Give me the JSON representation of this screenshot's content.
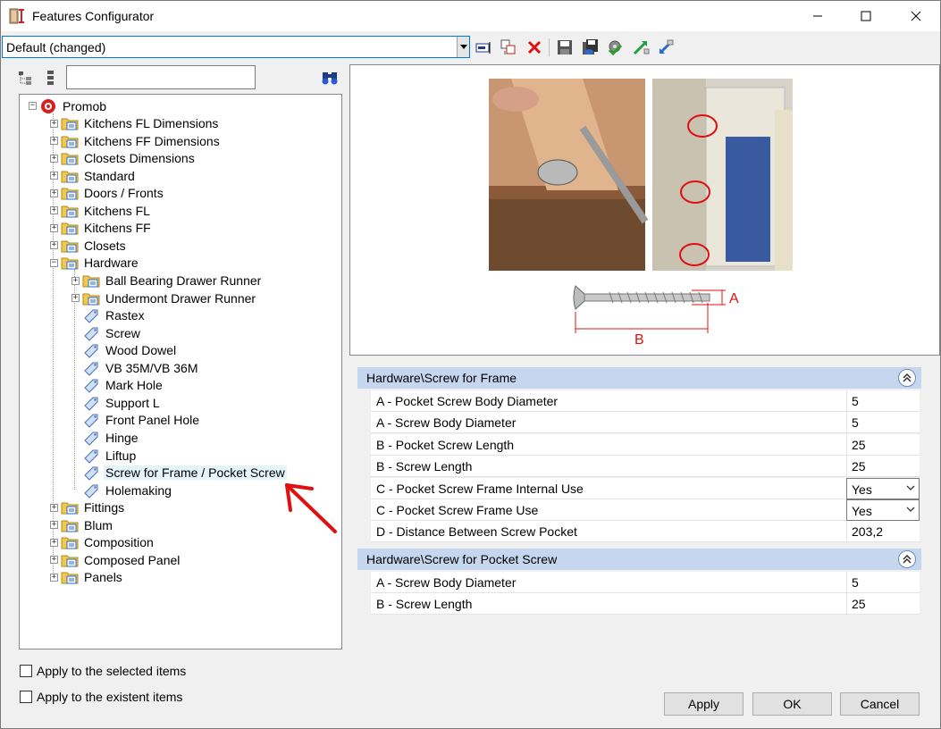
{
  "window": {
    "title": "Features Configurator"
  },
  "toolbar": {
    "profile": "Default (changed)",
    "icons": [
      "rename-icon",
      "copy-icon",
      "delete-icon",
      "save-icon",
      "save-as-icon",
      "settings-check-icon",
      "import-icon",
      "export-icon"
    ]
  },
  "tree": {
    "search_value": "",
    "root": "Promob",
    "items": [
      "Kitchens FL Dimensions",
      "Kitchens FF Dimensions",
      "Closets Dimensions",
      "Standard",
      "Doors / Fronts",
      "Kitchens FL",
      "Kitchens FF",
      "Closets",
      "Hardware"
    ],
    "hardware_children": [
      "Ball Bearing Drawer Runner",
      "Undermont Drawer Runner",
      "Rastex",
      "Screw",
      "Wood Dowel",
      "VB 35M/VB 36M",
      "Mark Hole",
      "Support L",
      "Front Panel Hole",
      "Hinge",
      "Liftup",
      "Screw for Frame / Pocket Screw",
      "Holemaking"
    ],
    "items_after": [
      "Fittings",
      "Blum",
      "Composition",
      "Composed Panel",
      "Panels"
    ],
    "selected": "Screw for Frame / Pocket Screw"
  },
  "options": {
    "apply_selected": "Apply to the selected items",
    "apply_existent": "Apply to the existent items"
  },
  "preview": {
    "label_a": "A",
    "label_b": "B"
  },
  "groups": [
    {
      "title": "Hardware\\Screw for Frame",
      "rows": [
        {
          "name": "A - Pocket Screw Body Diameter",
          "value": "5"
        },
        {
          "name": "A - Screw Body Diameter",
          "value": "5"
        },
        {
          "name": "B - Pocket Screw Length",
          "value": "25"
        },
        {
          "name": "B - Screw Length",
          "value": "25"
        },
        {
          "name": "C - Pocket Screw Frame Internal Use",
          "value": "Yes"
        },
        {
          "name": "C - Pocket Screw Frame Use",
          "value": "Yes"
        },
        {
          "name": "D - Distance Between Screw Pocket",
          "value": "203,2"
        }
      ]
    },
    {
      "title": "Hardware\\Screw for Pocket Screw",
      "rows": [
        {
          "name": "A - Screw Body Diameter",
          "value": "5"
        },
        {
          "name": "B - Screw Length",
          "value": "25"
        }
      ]
    }
  ],
  "buttons": {
    "apply": "Apply",
    "ok": "OK",
    "cancel": "Cancel"
  },
  "colors": {
    "accent": "#0078d7",
    "group_header": "#c5d6ee",
    "annotation_red": "#e01010"
  }
}
